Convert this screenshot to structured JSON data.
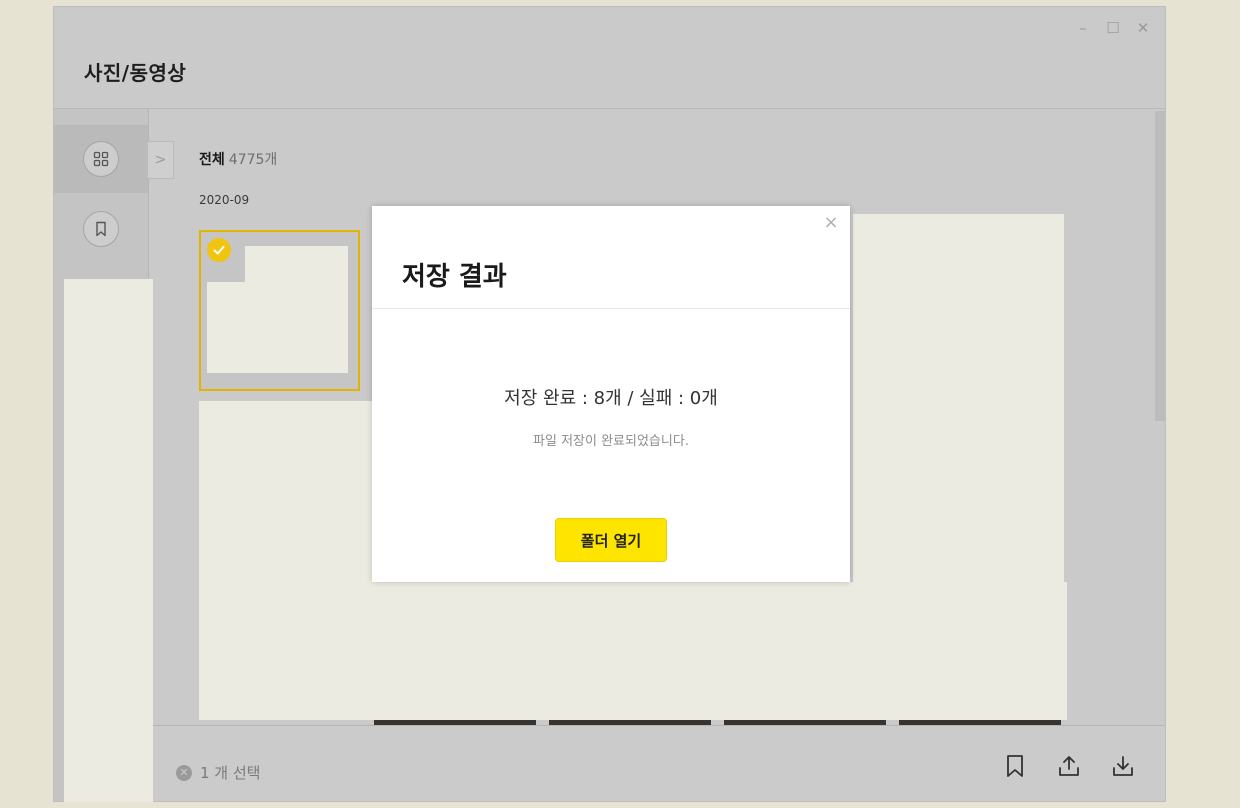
{
  "window": {
    "title": "사진/동영상",
    "controls": {
      "minimize": "–",
      "maximize": "☐",
      "close": "✕"
    }
  },
  "sidebar": {
    "items": [
      {
        "icon": "grid-icon",
        "active": true
      },
      {
        "icon": "bookmark-icon",
        "active": false
      }
    ]
  },
  "gallery": {
    "title": "전체",
    "count": "4775개",
    "date_group": "2020-09",
    "expand_glyph": ">"
  },
  "footer": {
    "selection_text": "1 개 선택",
    "actions": [
      "bookmark-icon",
      "share-icon",
      "download-icon"
    ]
  },
  "dialog": {
    "title": "저장 결과",
    "result": "저장 완료 : 8개 / 실패 : 0개",
    "message": "파일 저장이 완료되었습니다.",
    "button": "폴더 열기",
    "close_glyph": "×"
  },
  "colors": {
    "accent": "#fee500",
    "selection_border": "#e0b400",
    "overlay": "#cacaca",
    "mask": "#ecebe1"
  }
}
